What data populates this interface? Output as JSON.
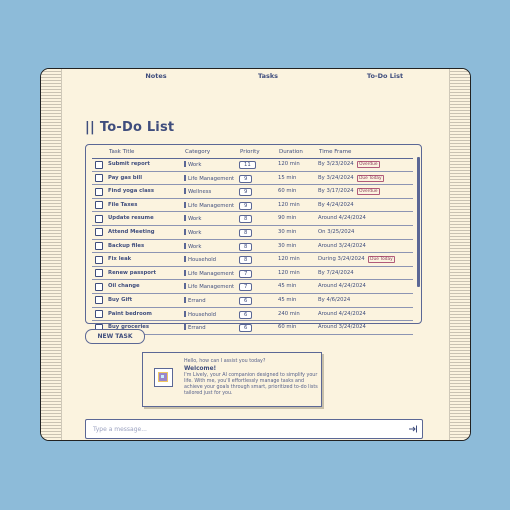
{
  "nav": {
    "items": [
      "Notes",
      "Tasks",
      "To-Do List"
    ]
  },
  "page_title": "To-Do List",
  "title_prefix": "||",
  "table": {
    "headers": [
      "Task Title",
      "Category",
      "Priority",
      "Duration",
      "Time Frame"
    ],
    "rows": [
      {
        "title": "Submit report",
        "category": "Work",
        "priority": "11",
        "duration": "120 min",
        "timeframe": "By 3/23/2024",
        "badge": "Overdue"
      },
      {
        "title": "Pay gas bill",
        "category": "Life Management",
        "priority": "9",
        "duration": "15 min",
        "timeframe": "By 3/24/2024",
        "badge": "Due Today"
      },
      {
        "title": "Find yoga class",
        "category": "Wellness",
        "priority": "9",
        "duration": "60 min",
        "timeframe": "By 3/17/2024",
        "badge": "Overdue"
      },
      {
        "title": "File Taxes",
        "category": "Life Management",
        "priority": "9",
        "duration": "120 min",
        "timeframe": "By 4/24/2024",
        "badge": ""
      },
      {
        "title": "Update resume",
        "category": "Work",
        "priority": "8",
        "duration": "90 min",
        "timeframe": "Around 4/24/2024",
        "badge": ""
      },
      {
        "title": "Attend Meeting",
        "category": "Work",
        "priority": "8",
        "duration": "30 min",
        "timeframe": "On 3/25/2024",
        "badge": ""
      },
      {
        "title": "Backup files",
        "category": "Work",
        "priority": "8",
        "duration": "30 min",
        "timeframe": "Around 3/24/2024",
        "badge": ""
      },
      {
        "title": "Fix leak",
        "category": "Household",
        "priority": "8",
        "duration": "120 min",
        "timeframe": "During 3/24/2024",
        "badge": "Due Today"
      },
      {
        "title": "Renew passport",
        "category": "Life Management",
        "priority": "7",
        "duration": "120 min",
        "timeframe": "By 7/24/2024",
        "badge": ""
      },
      {
        "title": "Oil change",
        "category": "Life Management",
        "priority": "7",
        "duration": "45 min",
        "timeframe": "Around 4/24/2024",
        "badge": ""
      },
      {
        "title": "Buy Gift",
        "category": "Errand",
        "priority": "6",
        "duration": "45 min",
        "timeframe": "By 4/6/2024",
        "badge": ""
      },
      {
        "title": "Paint bedroom",
        "category": "Household",
        "priority": "6",
        "duration": "240 min",
        "timeframe": "Around 4/24/2024",
        "badge": ""
      },
      {
        "title": "Buy groceries",
        "category": "Errand",
        "priority": "6",
        "duration": "60 min",
        "timeframe": "Around 3/24/2024",
        "badge": ""
      }
    ]
  },
  "new_task_label": "NEW TASK",
  "chat": {
    "greeting": "Hello, how can I assist you today?",
    "welcome": "Welcome!",
    "intro": "I'm Lively, your AI companion designed to simplify your life. With me, you'll effortlessly manage tasks and achieve your goals through smart, prioritized to-do lists tailored just for you."
  },
  "message_input": {
    "placeholder": "Type a message..."
  },
  "colors": {
    "background": "#8dbbd9",
    "panel": "#fbf3df",
    "accent": "#3f4d7d",
    "badge": "#b05b7a"
  }
}
